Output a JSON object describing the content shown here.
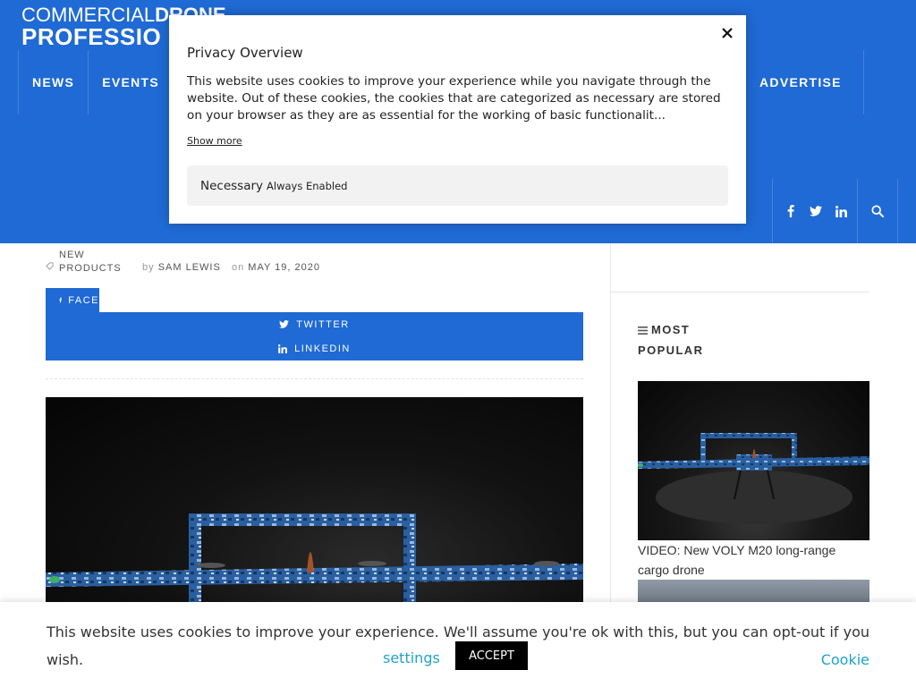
{
  "header": {
    "logo_line1_a": "COMMERCIAL",
    "logo_line1_b": "DRONE",
    "logo_line2": "PROFESSIO",
    "nav": [
      {
        "label": "NEWS"
      },
      {
        "label": "EVENTS"
      }
    ],
    "nav_right": {
      "label": "ADVERTISE"
    },
    "social": [
      {
        "icon": "facebook-icon",
        "glyph": "f"
      },
      {
        "icon": "twitter-icon",
        "glyph": "t"
      },
      {
        "icon": "linkedin-icon",
        "glyph": "in"
      }
    ],
    "search_icon": "search-icon"
  },
  "article": {
    "category_line1": "NEW",
    "category_line2": "PRODUCTS",
    "by_label": "by",
    "author": "SAM LEWIS",
    "on_label": "on",
    "date": "MAY 19, 2020",
    "share": {
      "facebook": "FACE",
      "twitter": "TWITTER",
      "linkedin": "LINKEDIN"
    }
  },
  "sidebar": {
    "most_popular_line1": "MOST",
    "most_popular_line2": "POPULAR",
    "item1_title_line1": "VIDEO: New VOLY M20 long-range",
    "item1_title_line2": "cargo drone"
  },
  "privacy_modal": {
    "title": "Privacy Overview",
    "text": "This website uses cookies to improve your experience while you navigate through the website. Out of these cookies, the cookies that are categorized as necessary are stored on your browser as they are as essential for the working of basic functionalit...",
    "show_more": "Show more",
    "necessary_label": "Necessary",
    "necessary_status": "Always Enabled"
  },
  "cookie_bar": {
    "text": "This website uses cookies to improve your experience. We'll assume you're ok with this, but you can opt-out if you wish.",
    "settings_part1": "Cookie",
    "settings_part2": "settings",
    "accept": "ACCEPT"
  },
  "colors": {
    "brand_blue": "#1f6ad4",
    "link_cyan": "#1fa3c9"
  }
}
